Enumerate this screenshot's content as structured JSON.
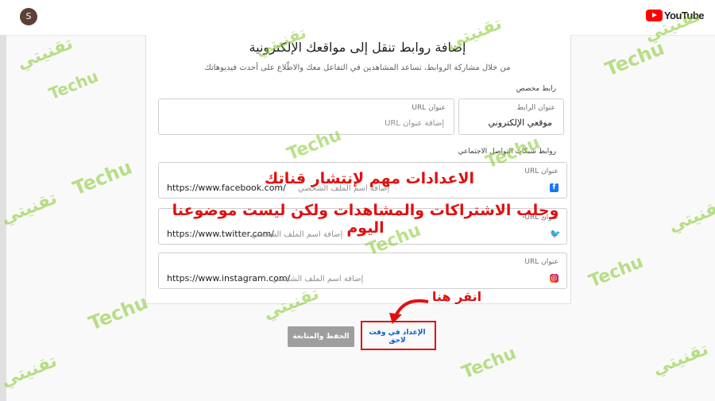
{
  "topbar": {
    "avatar_letter": "S",
    "brand": "YouTube"
  },
  "page": {
    "title": "إضافة روابط تنقل إلى مواقعك الإلكترونية",
    "subtitle": "من خلال مشاركة الروابط، تساعد المشاهدين في التفاعل معك والاطّلاع على أحدث فيديوهاتك"
  },
  "custom_link": {
    "section_label": "رابط مخصص",
    "title_field": {
      "label": "عنوان الرابط",
      "value": "موقعي الإلكتروني"
    },
    "url_field": {
      "label": "عنوان URL",
      "placeholder": "إضافة عنوان URL"
    }
  },
  "social_links": {
    "section_label": "روابط شبكات التواصل الاجتماعي",
    "items": [
      {
        "label": "عنوان URL",
        "prefix": "https://www.facebook.com/",
        "placeholder": "إضافة اسم الملف الشخصي",
        "icon": "facebook-icon",
        "color": "#1877f2"
      },
      {
        "label": "عنوان URL",
        "prefix": "https://www.twitter.com/",
        "placeholder": "إضافة اسم الملف الشخصي",
        "icon": "twitter-icon",
        "color": "#1da1f2"
      },
      {
        "label": "عنوان URL",
        "prefix": "https://www.instagram.com/",
        "placeholder": "إضافة اسم الملف الشخصي",
        "icon": "instagram-icon",
        "color": "#c13584"
      }
    ]
  },
  "actions": {
    "save_label": "الحفظ والمتابعة",
    "later_label": "الإعداد في وقت لاحق"
  },
  "annotations": {
    "line1": "الاعدادات مهم لإنتشار قناتك",
    "line2": "وجلب الاشتراكات والمشاهدات ولكن ليست موضوعنا اليوم",
    "click_here": "انقر هنا",
    "color": "#e01010"
  },
  "watermark": {
    "arabic": "تقنيتي",
    "latin": "Techu",
    "tag": "Mix"
  }
}
